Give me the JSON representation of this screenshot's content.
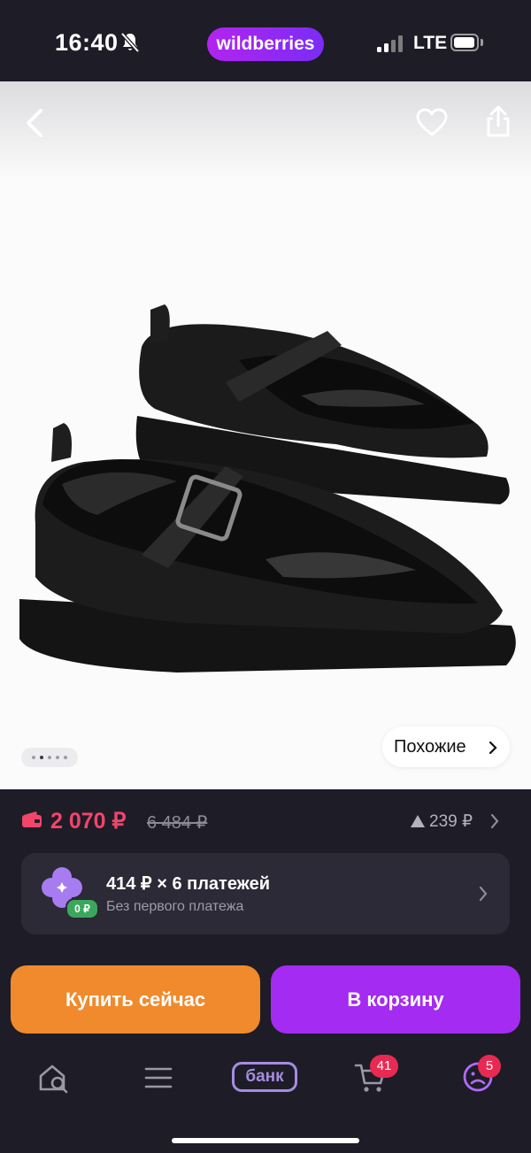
{
  "status_bar": {
    "time": "16:40",
    "brand": "wildberries",
    "network": "LTE",
    "icons": [
      "bell-muted-icon",
      "signal-icon",
      "battery-icon"
    ]
  },
  "product": {
    "image_alt": "",
    "top_icons": [
      "back-icon",
      "heart-icon",
      "share-icon"
    ],
    "gallery_pages": 5,
    "gallery_active": 2,
    "similar_label": "Похожие"
  },
  "price": {
    "current": "2 070 ₽",
    "old": "6 484 ₽",
    "delta": "239 ₽",
    "accent": "#f2456b"
  },
  "installments": {
    "title": "414 ₽ × 6 платежей",
    "subtitle": "Без первого платежа",
    "badge": "0 ₽"
  },
  "actions": {
    "buy_now": "Купить сейчас",
    "add_to_cart": "В корзину",
    "buy_color": "#f08a2c",
    "cart_color": "#a32bf2"
  },
  "tabbar": {
    "items": [
      "home-search-icon",
      "menu-icon",
      "bank-icon",
      "cart-icon",
      "profile-icon"
    ],
    "bank_label": "банк",
    "cart_count": "41",
    "profile_count": "5"
  }
}
